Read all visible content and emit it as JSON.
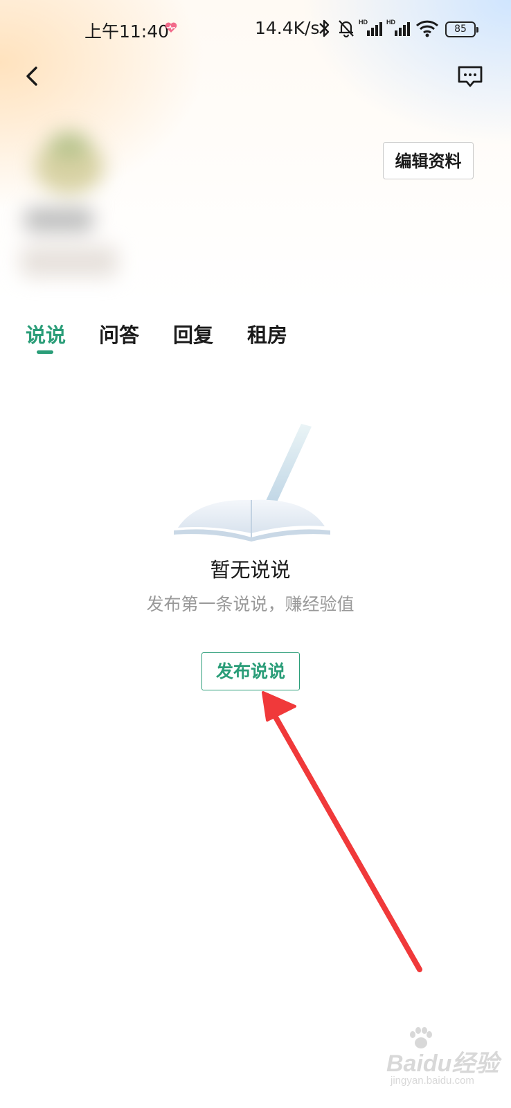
{
  "status_bar": {
    "time": "上午11:40",
    "net_speed": "14.4K/s",
    "battery": "85",
    "icons": [
      "heart-icon",
      "bluetooth-icon",
      "mute-bell-icon",
      "hd-signal-icon",
      "hd-signal-icon",
      "wifi-icon",
      "battery-icon"
    ]
  },
  "header": {
    "back_icon": "chevron-left-icon",
    "message_icon": "chat-bubble-icon"
  },
  "profile": {
    "edit_label": "编辑资料"
  },
  "tabs": [
    {
      "label": "说说",
      "active": true
    },
    {
      "label": "问答",
      "active": false
    },
    {
      "label": "回复",
      "active": false
    },
    {
      "label": "租房",
      "active": false
    }
  ],
  "empty_state": {
    "title": "暂无说说",
    "subtitle": "发布第一条说说，赚经验值",
    "button_label": "发布说说"
  },
  "watermark": {
    "logo": "Baidu经验",
    "url": "jingyan.baidu.com"
  },
  "colors": {
    "accent": "#2a9d78",
    "arrow": "#f0393a",
    "muted_text": "#999999"
  }
}
